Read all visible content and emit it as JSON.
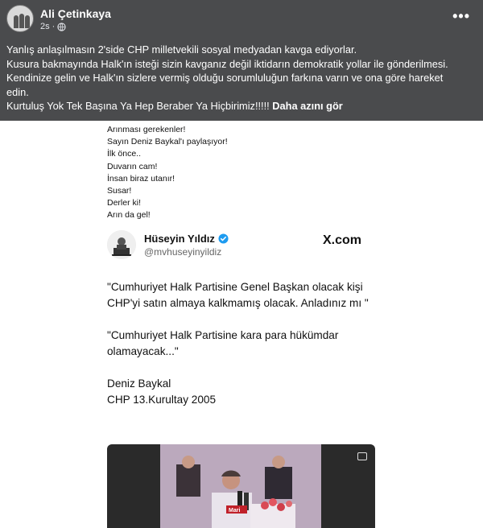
{
  "post": {
    "author": "Ali Çetinkaya",
    "time": "2s",
    "more_label": "•••",
    "lines": [
      "Yanlış anlaşılmasın 2'side CHP milletvekili sosyal medyadan kavga ediyorlar.",
      "Kusura bakmayında Halk'ın isteği sizin kavganız değil iktidarın demokratik yollar ile gönderilmesi.",
      "Kendinize gelin ve Halk'ın sizlere vermiş olduğu sorumluluğun farkına varın ve ona göre hareket",
      "edin.",
      "Kurtuluş Yok Tek Başına Ya Hep Beraber Ya Hiçbirimiz!!!!!"
    ],
    "see_more": "Daha azını gör"
  },
  "shared": {
    "poem_lines": [
      "Arınması gerekenler!",
      "Sayın Deniz Baykal'ı paylaşıyor!",
      "İlk önce..",
      "Duvarın cam!",
      "İnsan biraz utanır!",
      "Susar!",
      "Derler ki!",
      "Arın da gel!"
    ],
    "tweet": {
      "name": "Hüseyin Yıldız",
      "handle": "@mvhuseyinyildiz",
      "platform": "X.com",
      "paragraphs": [
        "\"Cumhuriyet Halk Partisine Genel Başkan olacak kişi CHP'yi satın almaya kalkmamış olacak. Anladınız mı \"",
        "\"Cumhuriyet Halk Partisine kara para hükümdar olamayacak...\""
      ],
      "signature": [
        "Deniz Baykal",
        "CHP 13.Kurultay 2005"
      ]
    },
    "video": {
      "caption_fragment": "Mari"
    }
  },
  "colors": {
    "header_bg": "#4a4b4d",
    "verified_blue": "#1d9bf0"
  },
  "icons": {
    "globe": "globe-icon",
    "more": "more-options-icon",
    "verified": "verified-badge-icon",
    "x_logo": "x-logo"
  }
}
